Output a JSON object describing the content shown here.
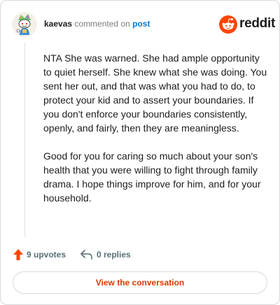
{
  "comment": {
    "username": "kaevas",
    "action_text": "commented on",
    "post_link": "post",
    "paragraphs": [
      "NTA She was warned. She had ample opportunity to quiet herself. She knew what she was doing. You sent her out, and that was what you had to do, to protect your kid and to assert your boundaries. If you don't enforce your boundaries consistently, openly, and fairly, then they are meaningless.",
      "Good for you for caring so much about your son's health that you were willing to fight through family drama. I hope things improve for him, and for your household."
    ]
  },
  "brand": {
    "name": "reddit",
    "color": "#ff4500"
  },
  "actions": {
    "upvotes_label": "9 upvotes",
    "replies_label": "0 replies",
    "upvote_icon": "upvote-arrow-icon",
    "reply_icon": "reply-arrow-icon",
    "upvote_color": "#ff4500"
  },
  "cta": {
    "label": "View the conversation",
    "color": "#d93a00"
  },
  "avatar": {
    "icon": "snoo-avatar-icon"
  }
}
